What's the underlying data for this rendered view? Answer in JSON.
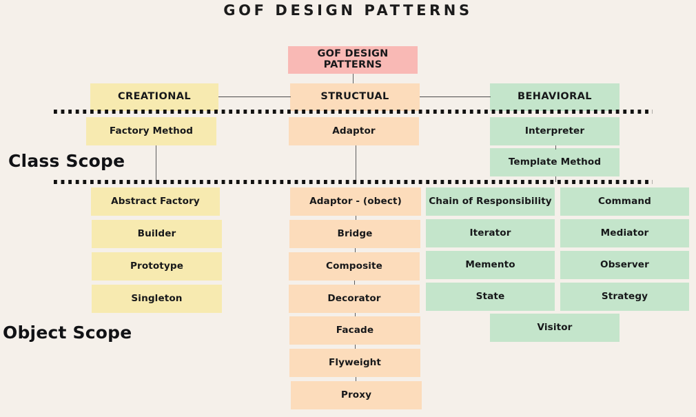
{
  "title": "GOF DESIGN PATTERNS",
  "root": {
    "label": "GOF DESIGN PATTERNS",
    "color": "#f9b9b5"
  },
  "scopes": {
    "class_label": "Class Scope",
    "object_label": "Object Scope"
  },
  "columns": [
    {
      "key": "creational",
      "header": "CREATIONAL",
      "color": "#f7eab0",
      "class_scope": [
        "Factory Method"
      ],
      "object_scope": [
        "Abstract Factory",
        "Builder",
        "Prototype",
        "Singleton"
      ]
    },
    {
      "key": "structural",
      "header": "STRUCTUAL",
      "color": "#fcdcbb",
      "class_scope": [
        "Adaptor"
      ],
      "object_scope": [
        "Adaptor - (obect)",
        "Bridge",
        "Composite",
        "Decorator",
        "Facade",
        "Flyweight",
        "Proxy"
      ]
    },
    {
      "key": "behavioral",
      "header": "BEHAVIORAL",
      "color": "#c4e5cb",
      "class_scope": [
        "Interpreter",
        "Template Method"
      ],
      "object_scope": [
        "Chain of Responsibility",
        "Iterator",
        "Memento",
        "State"
      ],
      "object_scope_right": [
        "Command",
        "Mediator",
        "Observer",
        "Strategy"
      ],
      "object_scope_last": [
        "Visitor"
      ]
    }
  ]
}
